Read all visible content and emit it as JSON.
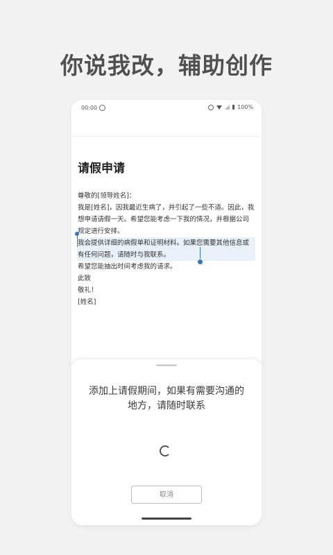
{
  "headline": "你说我改，辅助创作",
  "status_bar": {
    "time": "00:00",
    "battery": "100%"
  },
  "document": {
    "title": "请假申请",
    "lines": [
      "尊敬的[领导姓名]：",
      "我是[姓名]，因我最近生病了，并引起了一些不适。因此，我想申请请假一天。希望您能考虑一下我的情况，并根据公司规定进行安排。",
      "我会提供详细的病假单和证明材料。如果您需要其他信息或有任何问题，请随时与我联系。",
      "希望您能抽出时间考虑我的请求。",
      "此致",
      "敬礼！",
      "[姓名]"
    ]
  },
  "sheet": {
    "suggestion": "添加上请假期间，如果有需要沟通的地方，请随时联系",
    "cancel_label": "取消"
  },
  "colors": {
    "selection": "#e9f1fb",
    "handle": "#3b73c6"
  }
}
